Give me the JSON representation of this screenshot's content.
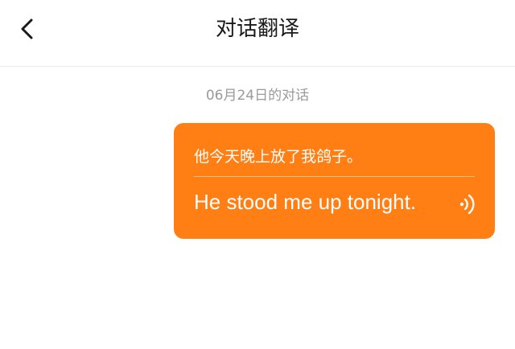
{
  "header": {
    "title": "对话翻译",
    "back_icon": "chevron-left-icon"
  },
  "conversation": {
    "date_label": "06月24日的对话",
    "messages": [
      {
        "source_text": "他今天晚上放了我鸽子。",
        "translation": "He stood me up tonight.",
        "speaker_icon": "speaker-icon",
        "bubble_color": "#ff7f14"
      }
    ]
  },
  "colors": {
    "accent": "#ff7f14",
    "title": "#1a1a1a",
    "date": "#9a9a9a",
    "background": "#ffffff"
  }
}
